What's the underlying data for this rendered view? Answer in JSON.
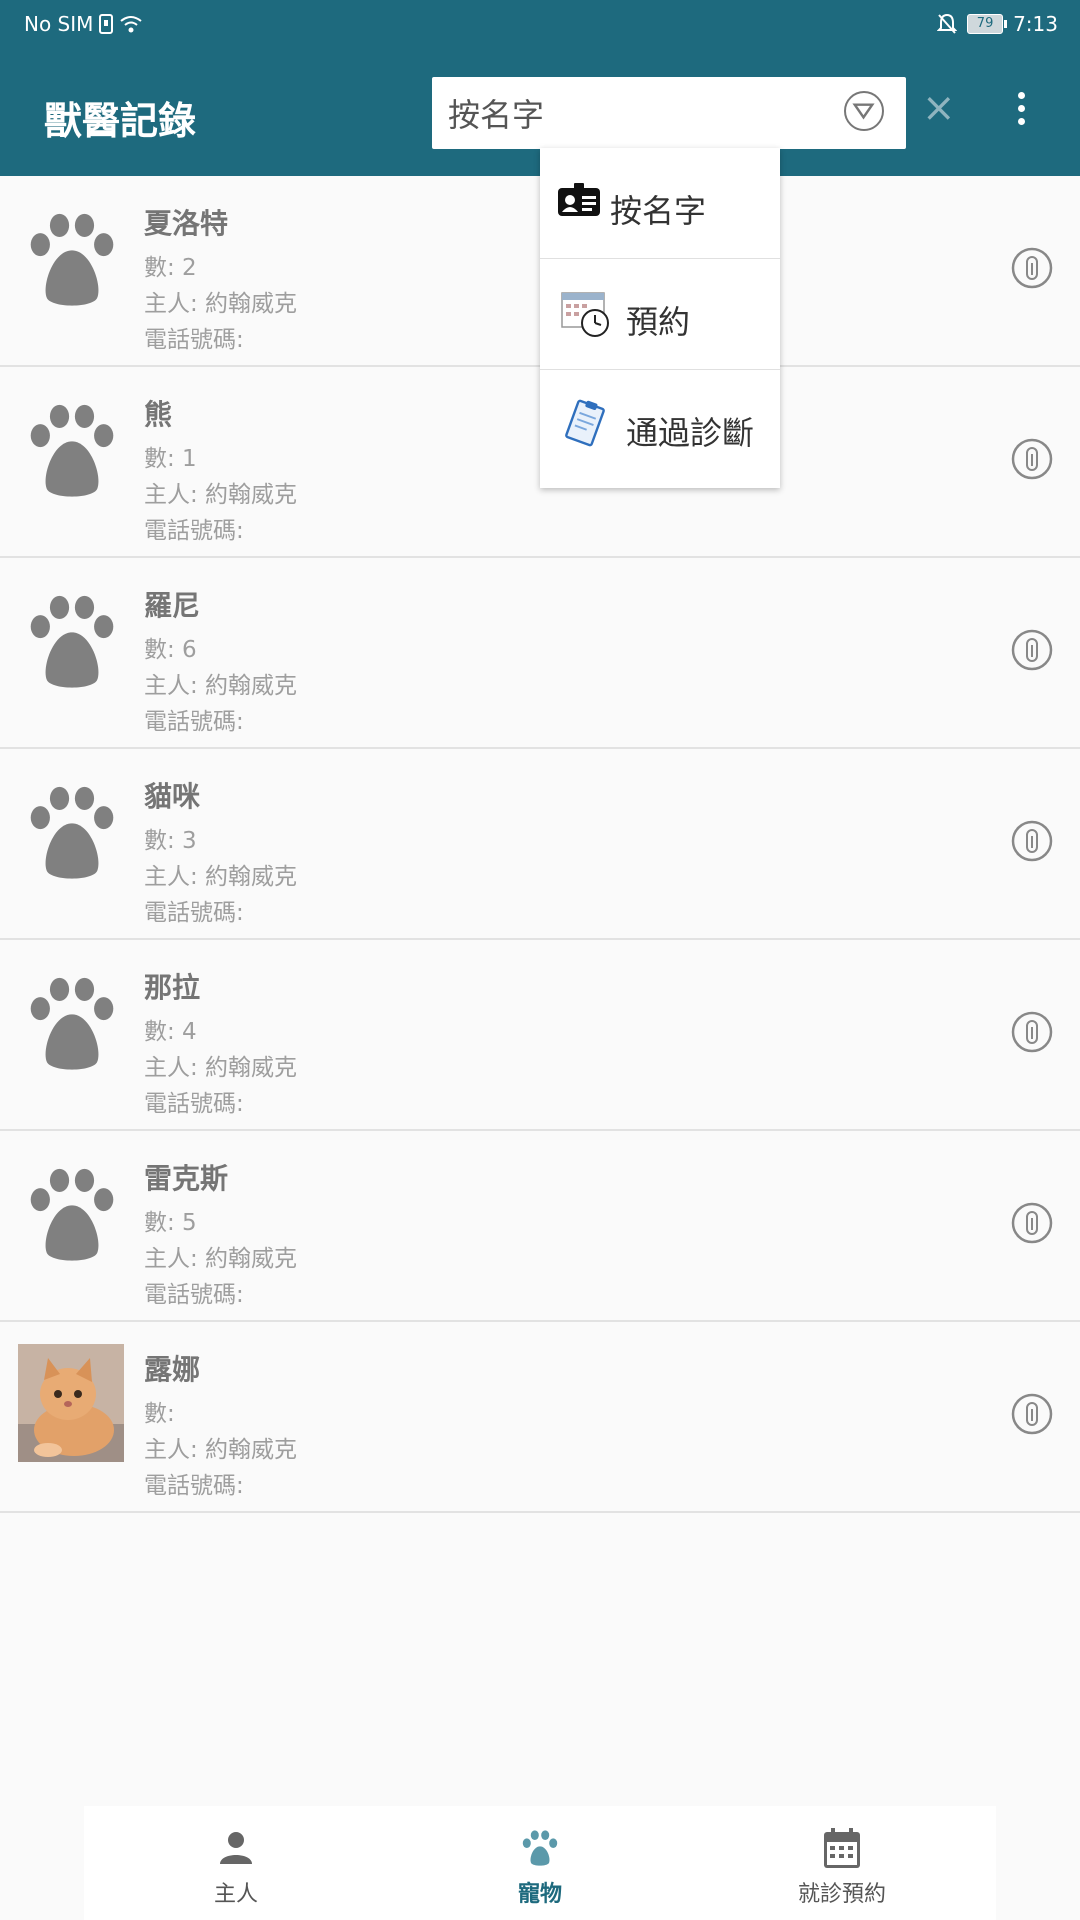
{
  "status_bar": {
    "carrier": "No SIM",
    "battery": "79",
    "time": "7:13"
  },
  "app_bar": {
    "title": "獸醫記錄",
    "search_value": "按名字",
    "close_label": "×"
  },
  "menu": {
    "items": [
      {
        "label": "按名字",
        "icon": "id-card-icon"
      },
      {
        "label": "預約",
        "icon": "calendar-clock-icon"
      },
      {
        "label": "通過診斷",
        "icon": "clipboard-icon"
      }
    ]
  },
  "pets": [
    {
      "name": "夏洛特",
      "count": "數: 2",
      "owner": "主人: 約翰威克",
      "phone": "電話號碼:",
      "avatar": "paw-icon"
    },
    {
      "name": "熊",
      "count": "數: 1",
      "owner": "主人: 約翰威克",
      "phone": "電話號碼:",
      "avatar": "paw-icon"
    },
    {
      "name": "羅尼",
      "count": "數: 6",
      "owner": "主人: 約翰威克",
      "phone": "電話號碼:",
      "avatar": "paw-icon"
    },
    {
      "name": "貓咪",
      "count": "數: 3",
      "owner": "主人: 約翰威克",
      "phone": "電話號碼:",
      "avatar": "paw-icon"
    },
    {
      "name": "那拉",
      "count": "數: 4",
      "owner": "主人: 約翰威克",
      "phone": "電話號碼:",
      "avatar": "paw-icon"
    },
    {
      "name": "雷克斯",
      "count": "數: 5",
      "owner": "主人: 約翰威克",
      "phone": "電話號碼:",
      "avatar": "paw-icon"
    },
    {
      "name": "露娜",
      "count": "數:",
      "owner": "主人: 約翰威克",
      "phone": "電話號碼:",
      "avatar": "cat-photo"
    }
  ],
  "bottom_nav": {
    "items": [
      {
        "label": "主人",
        "icon": "person-icon",
        "active": false
      },
      {
        "label": "寵物",
        "icon": "paw-icon",
        "active": true
      },
      {
        "label": "就診預約",
        "icon": "calendar-icon",
        "active": false
      }
    ]
  },
  "colors": {
    "primary": "#1e6a7e",
    "paw": "#808080",
    "background": "#fafafa"
  }
}
